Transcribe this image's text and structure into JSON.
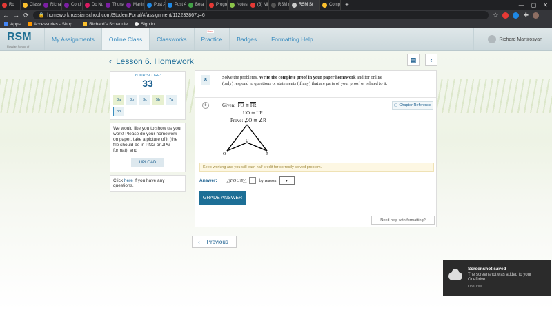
{
  "browser": {
    "tabs": [
      {
        "label": "Ro",
        "color": "#e53935"
      },
      {
        "label": "Classes",
        "color": "#fbc02d"
      },
      {
        "label": "Richard",
        "color": "#7b1fa2"
      },
      {
        "label": "Contin",
        "color": "#7b1fa2"
      },
      {
        "label": "Do Nur",
        "color": "#d81b60"
      },
      {
        "label": "Thursd",
        "color": "#7b1fa2"
      },
      {
        "label": "Martine",
        "color": "#7b1fa2"
      },
      {
        "label": "Post Ar",
        "color": "#1e88e5"
      },
      {
        "label": "Post Ar",
        "color": "#1e88e5"
      },
      {
        "label": "Beta",
        "color": "#43a047"
      },
      {
        "label": "Progre",
        "color": "#e53935"
      },
      {
        "label": "Notes",
        "color": "#8bc34a"
      },
      {
        "label": "(3) Mi",
        "color": "#e53935"
      },
      {
        "label": "RSM n",
        "color": "#555555"
      }
    ],
    "active_tab": "RSM St",
    "extra_tab": "Compu",
    "new_tab": "+",
    "url": "homework.russianschool.com/StudentPortal/#/assignment/112233867q=6",
    "bookmarks": [
      "Apps",
      "Accessories - Shop...",
      "Richard's Schedule",
      "Sign in"
    ]
  },
  "site": {
    "logo": "RSM",
    "logo_sub": "Russian School of Mathematics",
    "nav": [
      "My Assignments",
      "Online Class",
      "Classworks",
      "Practice",
      "Badges",
      "Formatting Help"
    ],
    "new_badge": "New",
    "user": "Richard Martirosyan"
  },
  "lesson": {
    "title": "Lesson 6. Homework"
  },
  "score": {
    "label": "YOUR SCORE:",
    "value": "33"
  },
  "problems": [
    {
      "label": "3a",
      "color": "#e7f0d0"
    },
    {
      "label": "3b",
      "color": "#e6f0f4"
    },
    {
      "label": "3c",
      "color": "#e6f0f4"
    },
    {
      "label": "5b",
      "color": "#e7f0d0"
    },
    {
      "label": "7a",
      "color": "#e6f0f4"
    },
    {
      "label": "8b",
      "color": "#e6f0f4"
    }
  ],
  "upload": {
    "text": "We would like you to show us your work! Please do your homework on paper, take a picture of it (the file should be in PNG or JPG format), and",
    "button": "UPLOAD"
  },
  "help": {
    "pre": "Click ",
    "link": "here",
    "post": " if you have any questions."
  },
  "question": {
    "number": "8",
    "intro": "Solve the problems. ",
    "bold": "Write the complete proof in your paper homework",
    "rest": " and for online (only) respond to questions or statements (if any) that are parts of your proof or related to it.",
    "part": "b",
    "given_label": "Given:",
    "fo": "FO",
    "fr": "FR",
    "uo": "UO",
    "ur": "UR",
    "cong": "≅",
    "prove": "Prove: ∠O ≅ ∠R",
    "chapter_btn": "Chapter Reference",
    "points": {
      "f": "F",
      "u": "U",
      "o": "O",
      "r": "R"
    }
  },
  "warning": "Keep working and you will earn half credit for correctly solved problem.",
  "answer": {
    "label": "Answer:",
    "expr": "△FOU≅△",
    "reason": "by reason",
    "select": "▾"
  },
  "grade_button": "GRADE ANSWER",
  "need_help": "Need help with formatting?",
  "previous": "Previous",
  "toast": {
    "title": "Screenshot saved",
    "body": "The screenshot was added to your OneDrive.",
    "app": "OneDrive"
  }
}
